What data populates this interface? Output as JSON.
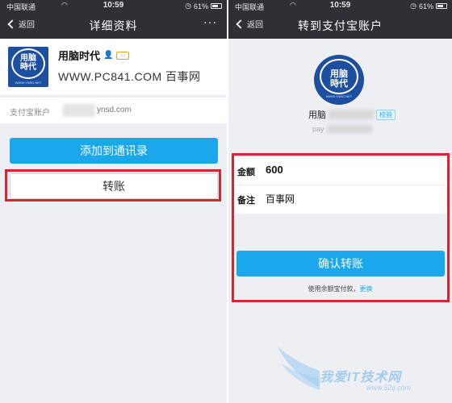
{
  "status_bar": {
    "carrier": "中国联通",
    "time": "10:59",
    "battery": "61%",
    "battery_level": 0.61
  },
  "left_screen": {
    "nav": {
      "back_label": "返回",
      "title": "详细资料",
      "more_label": "···"
    },
    "profile": {
      "name": "用脑时代",
      "watermark": "WWW.PC841.COM 百事网"
    },
    "logo": {
      "text_line1": "用脑",
      "text_line2": "時代",
      "url": "WWW.YNSD.NET"
    },
    "account": {
      "label": "支付宝账户",
      "value": "ynsd.com"
    },
    "add_contact_label": "添加到通讯录",
    "transfer_label": "转账"
  },
  "right_screen": {
    "nav": {
      "back_label": "返回",
      "title": "转到支付宝账户"
    },
    "recipient": {
      "name_prefix": "用脑",
      "verified_label": "校验",
      "account_prefix": "pay"
    },
    "form": {
      "amount_label": "金额",
      "amount_value": "600",
      "note_label": "备注",
      "note_value": "百事网"
    },
    "confirm_label": "确认转账",
    "pay_note": "使用余额宝付款，",
    "change_link": "更换"
  },
  "site_watermark": {
    "text": "我爱IT技术网",
    "url": "www.52ij.com"
  },
  "colors": {
    "navbar": "#2d3034",
    "accent_blue": "#1aa7ec",
    "highlight_red": "#d3262e",
    "page_bg": "#eeeff3",
    "logo_blue": "#1c4fa0"
  }
}
